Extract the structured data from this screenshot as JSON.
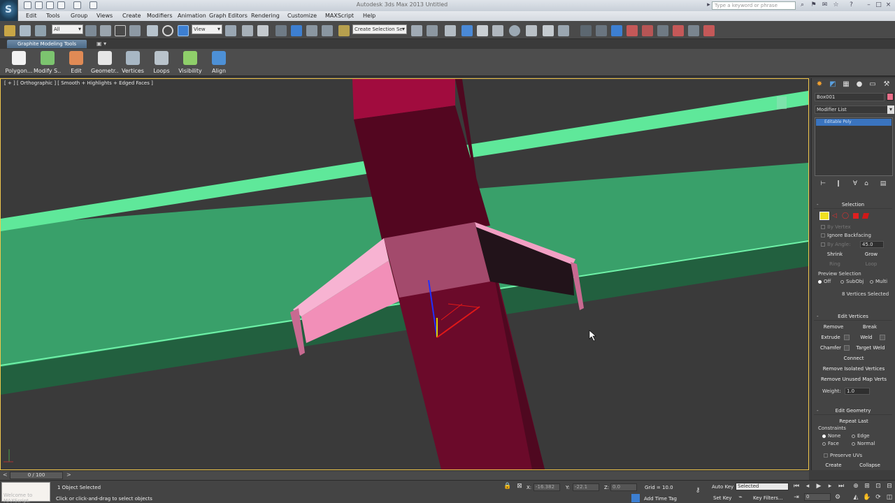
{
  "titlebar": {
    "app_logo_letter": "S",
    "window_title": "Autodesk 3ds Max 2013   Untitled",
    "search_placeholder": "Type a keyword or phrase"
  },
  "menu": {
    "items": [
      "Edit",
      "Tools",
      "Group",
      "Views",
      "Create",
      "Modifiers",
      "Animation",
      "Graph Editors",
      "Rendering",
      "Customize",
      "MAXScript",
      "Help"
    ]
  },
  "toolbar": {
    "selection_filter": "All",
    "ref_coord": "View",
    "named_selection": "Create Selection Se"
  },
  "ribbon": {
    "tab_label": "Graphite Modeling Tools",
    "tab_dropdown": "▣ ▾",
    "buttons": [
      "Polygon...",
      "Modify S...",
      "Edit",
      "Geometr...",
      "Vertices",
      "Loops",
      "Visibility",
      "Align"
    ]
  },
  "viewport": {
    "label": "[ + ] [ Orthographic ] [ Smooth + Highlights + Edged Faces ]"
  },
  "command_panel": {
    "object_name": "Box001",
    "modifier_list": "Modifier List",
    "stack_item": "Editable Poly",
    "selection": {
      "title": "Selection",
      "by_vertex": "By Vertex",
      "ignore_backfacing": "Ignore Backfacing",
      "by_angle": "By Angle:",
      "by_angle_value": "45.0",
      "shrink": "Shrink",
      "grow": "Grow",
      "ring": "Ring",
      "loop": "Loop",
      "preview_selection": "Preview Selection",
      "preview_options": [
        "Off",
        "SubObj",
        "Multi"
      ],
      "status": "8 Vertices Selected"
    },
    "edit_vertices": {
      "title": "Edit Vertices",
      "remove": "Remove",
      "break": "Break",
      "extrude": "Extrude",
      "weld": "Weld",
      "chamfer": "Chamfer",
      "target_weld": "Target Weld",
      "connect": "Connect",
      "remove_isolated": "Remove Isolated Vertices",
      "remove_unused": "Remove Unused Map Verts",
      "weight_label": "Weight:",
      "weight_value": "1.0"
    },
    "edit_geometry": {
      "title": "Edit Geometry",
      "repeat_last": "Repeat Last",
      "constraints": "Constraints",
      "none": "None",
      "edge": "Edge",
      "face": "Face",
      "normal": "Normal",
      "preserve_uvs": "Preserve UVs",
      "create": "Create",
      "collapse": "Collapse"
    }
  },
  "timeline": {
    "frame": "0 / 100"
  },
  "status": {
    "maxscript": "Welcome to MAXScript.",
    "objects_selected": "1 Object Selected",
    "prompt": "Click or click-and-drag to select objects",
    "x_label": "X:",
    "x_value": "-16.382",
    "y_label": "Y:",
    "y_value": "-22.1",
    "z_label": "Z:",
    "z_value": "0.0",
    "grid": "Grid = 10.0",
    "add_time_tag": "Add Time Tag",
    "auto_key": "Auto Key",
    "set_key": "Set Key",
    "selected": "Selected",
    "key_filters": "Key Filters...",
    "frame_field": "0"
  },
  "colors": {
    "accent_blue": "#3a74bf",
    "viewport_border": "#f0c64c",
    "green_object": "#39a06a",
    "pink_selected": "#f28fb8",
    "maroon_object": "#6b0a2a"
  }
}
